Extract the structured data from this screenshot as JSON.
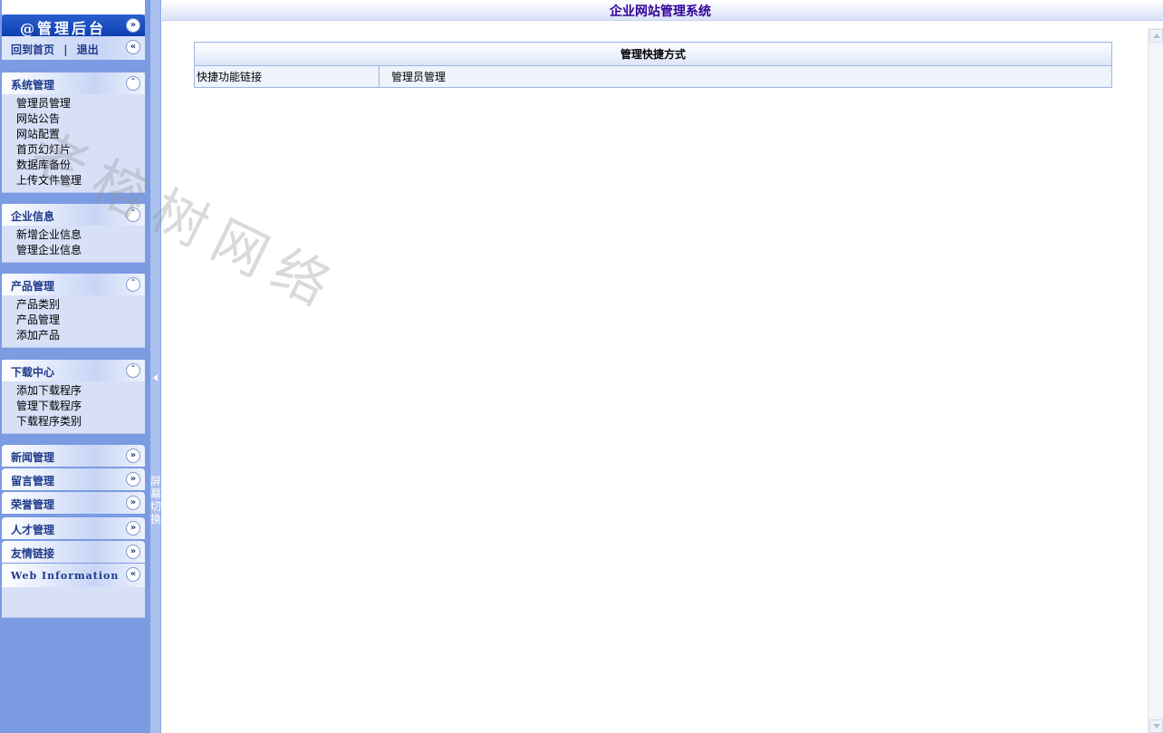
{
  "sidebar": {
    "brand": "@管理后台",
    "home_links": {
      "home": "回到首页",
      "sep": "|",
      "logout": "退出"
    },
    "panels": [
      {
        "title": "系统管理",
        "items": [
          "管理员管理",
          "网站公告",
          "网站配置",
          "首页幻灯片",
          "数据库备份",
          "上传文件管理"
        ]
      },
      {
        "title": "企业信息",
        "items": [
          "新增企业信息",
          "管理企业信息"
        ]
      },
      {
        "title": "产品管理",
        "items": [
          "产品类别",
          "产品管理",
          "添加产品"
        ]
      },
      {
        "title": "下载中心",
        "items": [
          "添加下载程序",
          "管理下载程序",
          "下载程序类别"
        ]
      }
    ],
    "collapsed": [
      "新闻管理",
      "留言管理",
      "荣誉管理",
      "人才管理",
      "友情链接"
    ],
    "web_info": "Web Information",
    "splitter_label": "屏幕切换"
  },
  "header": {
    "title": "企业网站管理系统"
  },
  "quick": {
    "title": "管理快捷方式",
    "label": "快捷功能链接",
    "link": "管理员管理"
  },
  "watermark": "老榕树网络",
  "icons": {
    "expand": "chevron-double-down-icon",
    "collapse": "chevron-double-up-icon",
    "left": "chevron-double-left-icon"
  }
}
